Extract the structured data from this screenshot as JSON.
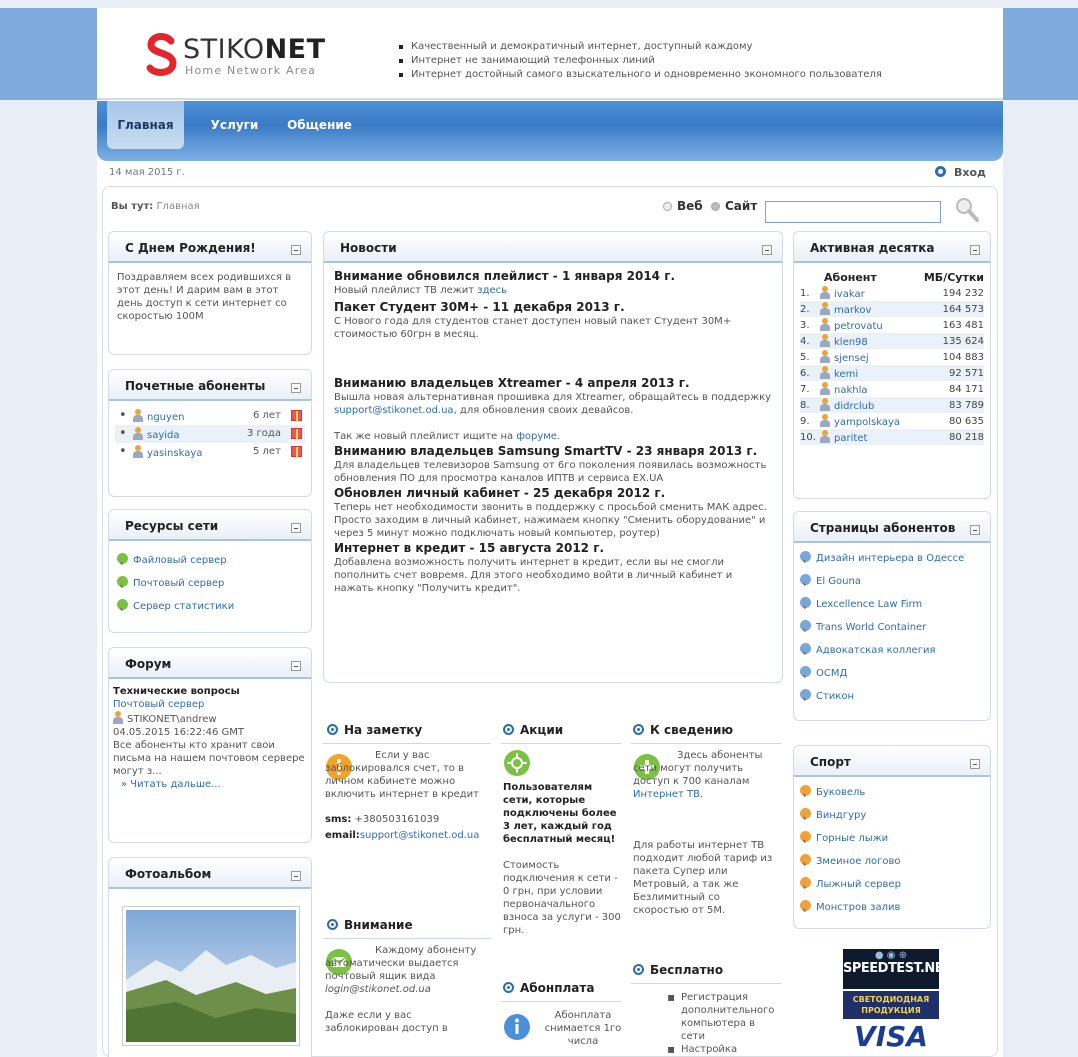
{
  "header": {
    "logo_name_a": "STIKO",
    "logo_name_b": "NET",
    "logo_tagline": "Home Network Area",
    "slogans": [
      "Качественный и демократичный интернет, доступный каждому",
      "Интернет не занимающий телефонных линий",
      "Интернет достойный самого взыскательного и одновременно экономного пользователя"
    ]
  },
  "nav": {
    "tabs": [
      {
        "label": "Главная"
      },
      {
        "label": "Услуги"
      },
      {
        "label": "Общение"
      }
    ]
  },
  "date": "14 мая 2015 г.",
  "login_label": "Вход",
  "breadcrumb": {
    "prefix": "Вы тут:",
    "current": "Главная"
  },
  "search": {
    "opt_web": "Веб",
    "opt_site": "Сайт",
    "value": ""
  },
  "birthday": {
    "title": "С Днем Рождения!",
    "text": "Поздравляем всех родившихся в этот день! И дарим вам в этот день доступ к сети интернет со скоростью 100М"
  },
  "honored": {
    "title": "Почетные абоненты",
    "items": [
      {
        "name": "nguyen",
        "years": "6 лет"
      },
      {
        "name": "sayida",
        "years": "3 года"
      },
      {
        "name": "yasinskaya",
        "years": "5 лет"
      }
    ]
  },
  "resources": {
    "title": "Ресурсы сети",
    "items": [
      "Файловый сервер",
      "Почтовый сервер",
      "Сервер статистики"
    ]
  },
  "forum": {
    "title": "Форум",
    "topic": "Технические вопросы",
    "sub": "Почтовый сервер",
    "user": "STIKONET\\andrew",
    "datetime": "04.05.2015 16:22:46 GMT",
    "excerpt": "Все абоненты кто хранит свои письма на нашем почтовом сервере могут з...",
    "more": "» Читать дальше..."
  },
  "photo": {
    "title": "Фотоальбом"
  },
  "news": {
    "title": "Новости",
    "items": [
      {
        "h": "Внимание обновился плейлист - 1 января 2014 г.",
        "t": "Новый плейлист ТВ лежит ",
        "link": "здесь"
      },
      {
        "h": "Пакет Студент 30М+ - 11 декабря 2013 г.",
        "t": "С Нового года для студентов станет доступен новый пакет Студент 30М+ стоимостью 60грн в месяц."
      },
      {
        "h": "Вниманию владельцев Xtreamer - 4 апреля 2013 г.",
        "t": "Вышла новая альтернативная прошивка для Xtreamer, обращайтесь в поддержку ",
        "link": "support@stikonet.od.ua",
        "t2": ", для обновления своих девайсов.",
        "t3": "Так же новый плейлист ищите на ",
        "link2": "форуме",
        "t4": "."
      },
      {
        "h": "Вниманию владельцев Samsung SmartTV - 23 января 2013 г.",
        "t": "Для владельцев телевизоров Samsung от 6го поколения появилась возможность обновления ПО для просмотра каналов ИПТВ и сервиса EX.UA"
      },
      {
        "h": "Обновлен личный кабинет - 25 декабря 2012 г.",
        "t": "Теперь нет необходимости звонить в поддержку с просьбой сменить МАК адрес. Просто заходим в личный кабинет, нажимаем кнопку \"Сменить оборудование\" и через 5 минут можно подключать новый компьютер, роутер)"
      },
      {
        "h": "Интернет в кредит - 15 августа 2012 г.",
        "t": "Добавлена возможность получить интернет в кредит, если вы не смогли пополнить счет вовремя. Для этого необходимо войти в личный кабинет и нажать кнопку \"Получить кредит\"."
      }
    ]
  },
  "note": {
    "title": "На заметку",
    "text": "Если у вас заблокировался счет, то в личном кабинете можно включить интернет в кредит",
    "sms_label": "sms:",
    "sms": "+380503161039",
    "email_label": "email:",
    "email": "support@stikonet.od.ua"
  },
  "attention": {
    "title": "Внимание",
    "text": "Каждому абоненту автоматически выдается почтовый ящик вида",
    "mail": "login@stikonet.od.ua",
    "text2": "Даже если у вас заблокирован доступ в"
  },
  "promo": {
    "title": "Акции",
    "bold": "Пользователям сети, которые подключены более 3 лет, каждый год бесплатный месяц!",
    "text": "Стоимость подключения к сети - 0 грн, при условии первоначального взноса за услуги - 300 грн."
  },
  "fee": {
    "title": "Абонплата",
    "text": "Абонплата снимается 1го числа"
  },
  "info": {
    "title": "К сведению",
    "text": "Здесь абоненты сети могут получить доступ к 700 каналам ",
    "link": "Интернет ТВ.",
    "text2": "Для работы интернет ТВ подходит любой тариф из пакета Супер или Метровый, а так же Безлимитный со скоростью от 5М."
  },
  "free": {
    "title": "Бесплатно",
    "items": [
      "Регистрация дополнительного компьютера в сети",
      "Настройка"
    ]
  },
  "top10": {
    "title": "Активная десятка",
    "col_user": "Абонент",
    "col_mb": "МБ/Сутки",
    "rows": [
      {
        "n": "1.",
        "user": "ivakar",
        "mb": "194 232"
      },
      {
        "n": "2.",
        "user": "markov",
        "mb": "164 573"
      },
      {
        "n": "3.",
        "user": "petrovatu",
        "mb": "163 481"
      },
      {
        "n": "4.",
        "user": "klen98",
        "mb": "135 624"
      },
      {
        "n": "5.",
        "user": "sjensej",
        "mb": "104 883"
      },
      {
        "n": "6.",
        "user": "kemi",
        "mb": "92 571"
      },
      {
        "n": "7.",
        "user": "nakhla",
        "mb": "84 171"
      },
      {
        "n": "8.",
        "user": "didrclub",
        "mb": "83 789"
      },
      {
        "n": "9.",
        "user": "yampolskaya",
        "mb": "80 635"
      },
      {
        "n": "10.",
        "user": "paritet",
        "mb": "80 218"
      }
    ]
  },
  "pages": {
    "title": "Страницы абонентов",
    "items": [
      "Дизайн интерьера в Одессе",
      "El Gouna",
      "Lexcellence Law Firm",
      "Trans World Container",
      "Адвокатская коллегия",
      "ОСМД",
      "Стикон"
    ]
  },
  "sport": {
    "title": "Спорт",
    "items": [
      "Буковель",
      "Виндгуру",
      "Горные лыжи",
      "Змеиное логово",
      "Лыжный сервер",
      "Монстров залив"
    ]
  },
  "banners": {
    "speedtest": "SPEEDTEST.NET",
    "led": "СВЕТОДИОДНАЯ ПРОДУКЦИЯ",
    "visa": "VISA"
  }
}
